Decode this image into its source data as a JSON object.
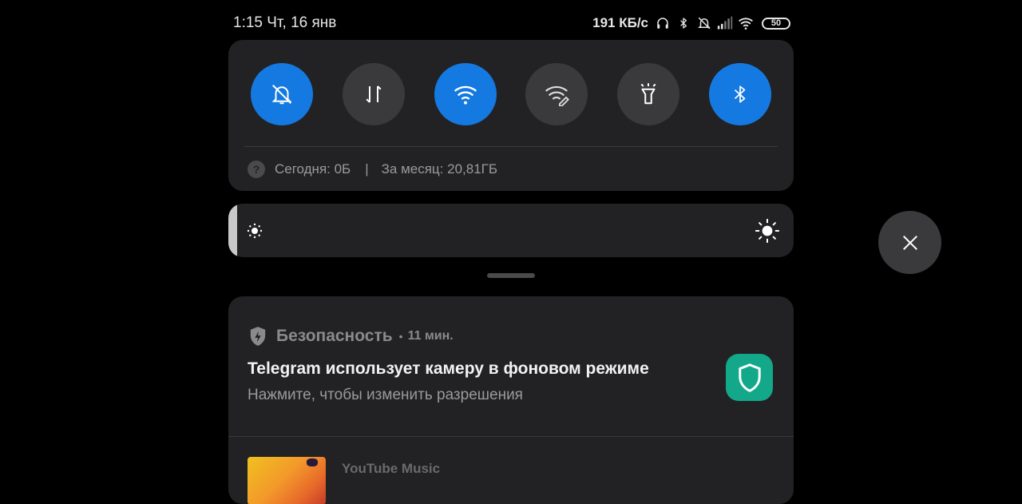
{
  "status_bar": {
    "time_date": "1:15 Чт, 16 янв",
    "net_speed": "191 КБ/с",
    "icons": [
      "headphones-icon",
      "bluetooth-icon",
      "alarm-off-icon",
      "signal-icon",
      "wifi-icon"
    ],
    "battery": "50"
  },
  "quick_tiles": [
    {
      "name": "silent",
      "icon": "bell-off-icon",
      "active": true
    },
    {
      "name": "mobile-data",
      "icon": "data-arrows-icon",
      "active": false
    },
    {
      "name": "wifi",
      "icon": "wifi-icon",
      "active": true
    },
    {
      "name": "wifi-edit",
      "icon": "wifi-edit-icon",
      "active": false
    },
    {
      "name": "flashlight",
      "icon": "flashlight-icon",
      "active": false
    },
    {
      "name": "bluetooth",
      "icon": "bluetooth-icon",
      "active": true
    }
  ],
  "data_usage": {
    "today": "Сегодня: 0Б",
    "separator": "|",
    "month": "За месяц: 20,81ГБ",
    "help_glyph": "?"
  },
  "brightness": {
    "level": 0.015
  },
  "notification": {
    "app_name": "Безопасность",
    "dot": "•",
    "time": "11 мин.",
    "title": "Telegram использует камеру в фоновом режиме",
    "text": "Нажмите, чтобы изменить разрешения"
  },
  "music_notification": {
    "app_name": "YouTube Music"
  },
  "colors": {
    "accent": "#1479e0",
    "panel": "#222224",
    "inactive_tile": "#3a3a3c",
    "security_icon_bg": "#14a88a"
  }
}
